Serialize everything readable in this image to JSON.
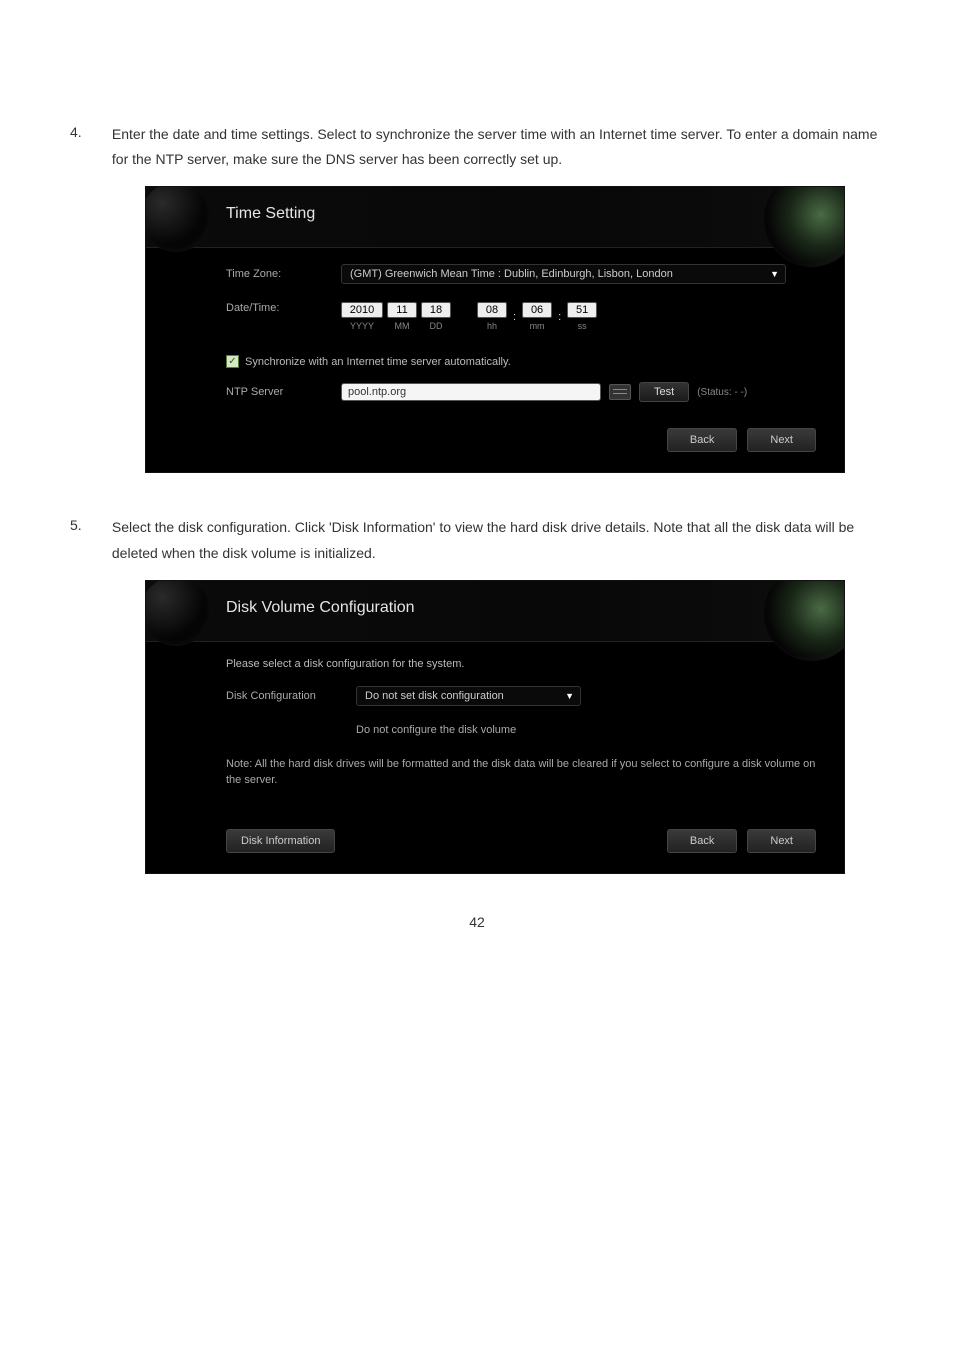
{
  "step4": {
    "number": "4.",
    "text": "Enter the date and time settings.   Select to synchronize the server time with an Internet time server.   To enter a domain name for the NTP server, make sure the DNS server has been correctly set up.",
    "panel": {
      "title": "Time Setting",
      "timezone_label": "Time Zone:",
      "timezone_value": "(GMT) Greenwich Mean Time : Dublin, Edinburgh, Lisbon, London",
      "datetime_label": "Date/Time:",
      "date": {
        "yyyy": "2010",
        "mm": "11",
        "dd": "18"
      },
      "time": {
        "hh": "08",
        "mm": "06",
        "ss": "51"
      },
      "sublabels": {
        "yyyy": "YYYY",
        "mm_date": "MM",
        "dd": "DD",
        "hh": "hh",
        "mm_time": "mm",
        "ss": "ss"
      },
      "checkbox_label": "Synchronize with an Internet time server automatically.",
      "ntp_label": "NTP Server",
      "ntp_value": "pool.ntp.org",
      "test_btn": "Test",
      "status_text": "(Status: - -)",
      "back_btn": "Back",
      "next_btn": "Next"
    }
  },
  "step5": {
    "number": "5.",
    "text": "Select the disk configuration.   Click 'Disk Information' to view the hard disk drive details.   Note that all the disk data will be deleted when the disk volume is initialized.",
    "panel": {
      "title": "Disk Volume Configuration",
      "intro": "Please select a disk configuration for the system.",
      "config_label": "Disk Configuration",
      "config_value": "Do not set disk configuration",
      "description": "Do not configure the disk volume",
      "note": "Note: All the hard disk drives will be formatted and the disk data will be cleared if you select to configure a disk volume on the server.",
      "info_btn": "Disk Information",
      "back_btn": "Back",
      "next_btn": "Next"
    }
  },
  "page_number": "42"
}
